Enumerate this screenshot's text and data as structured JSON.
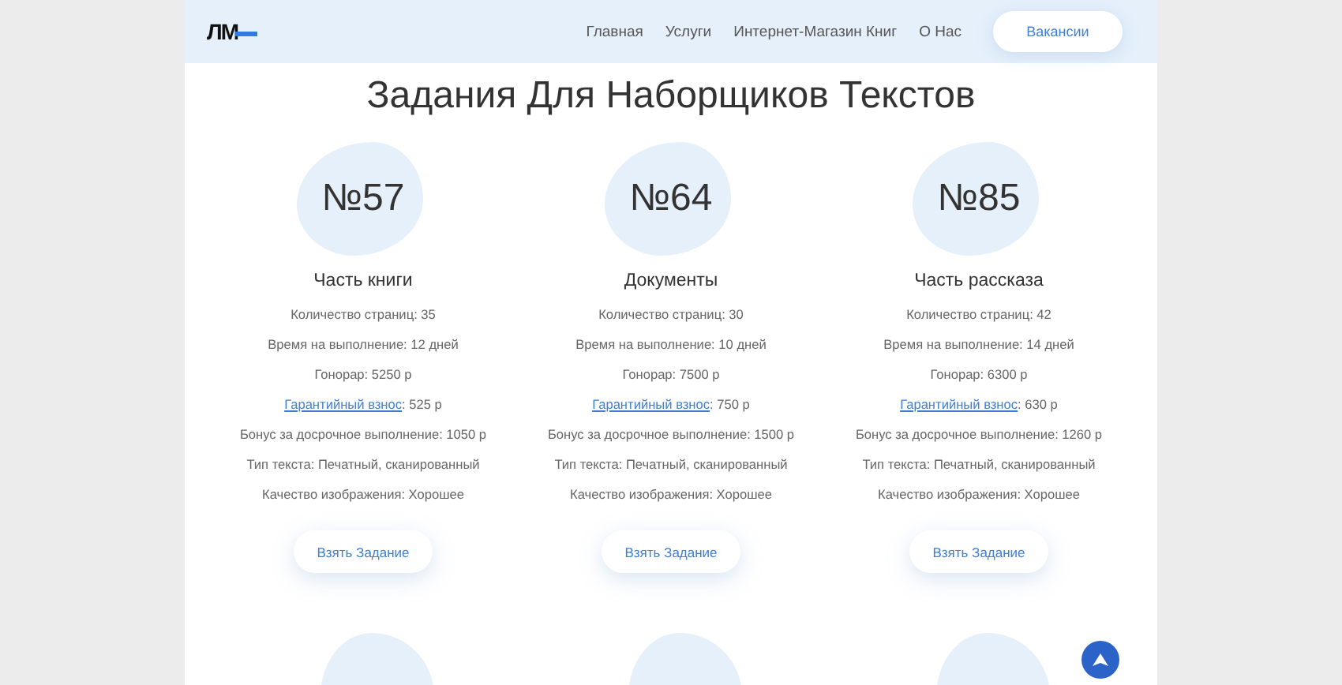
{
  "header": {
    "logo": "ЛМ",
    "nav": [
      "Главная",
      "Услуги",
      "Интернет-Магазин Книг",
      "О Нас"
    ],
    "button": "Вакансии"
  },
  "title": "Задания Для Наборщиков Текстов",
  "cards": [
    {
      "number": "№57",
      "heading": "Часть книги",
      "rows": [
        {
          "kind": "text",
          "text": "Количество страниц: 35"
        },
        {
          "kind": "text",
          "text": "Время на выполнение: 12 дней"
        },
        {
          "kind": "text",
          "text": "Гонорар: 5250 р"
        },
        {
          "kind": "link",
          "link": "Гарантийный взнос",
          "text": ": 525 р"
        },
        {
          "kind": "text",
          "text": "Бонус за досрочное выполнение: 1050 р"
        },
        {
          "kind": "text",
          "text": "Тип текста: Печатный, сканированный"
        },
        {
          "kind": "text",
          "text": "Качество изображения: Хорошее"
        }
      ],
      "button": "Взять Задание"
    },
    {
      "number": "№64",
      "heading": "Документы",
      "rows": [
        {
          "kind": "text",
          "text": "Количество страниц: 30"
        },
        {
          "kind": "text",
          "text": "Время на выполнение: 10 дней"
        },
        {
          "kind": "text",
          "text": "Гонорар: 7500 р"
        },
        {
          "kind": "link",
          "link": "Гарантийный взнос",
          "text": ": 750 р"
        },
        {
          "kind": "text",
          "text": "Бонус за досрочное выполнение: 1500 р"
        },
        {
          "kind": "text",
          "text": "Тип текста: Печатный, сканированный"
        },
        {
          "kind": "text",
          "text": "Качество изображения: Хорошее"
        }
      ],
      "button": "Взять Задание"
    },
    {
      "number": "№85",
      "heading": "Часть рассказа",
      "rows": [
        {
          "kind": "text",
          "text": "Количество страниц: 42"
        },
        {
          "kind": "text",
          "text": "Время на выполнение: 14 дней"
        },
        {
          "kind": "text",
          "text": "Гонорар: 6300 р"
        },
        {
          "kind": "link",
          "link": "Гарантийный взнос",
          "text": ": 630 р"
        },
        {
          "kind": "text",
          "text": "Бонус за досрочное выполнение: 1260 р"
        },
        {
          "kind": "text",
          "text": "Тип текста: Печатный, сканированный"
        },
        {
          "kind": "text",
          "text": "Качество изображения: Хорошее"
        }
      ],
      "button": "Взять Задание"
    }
  ]
}
